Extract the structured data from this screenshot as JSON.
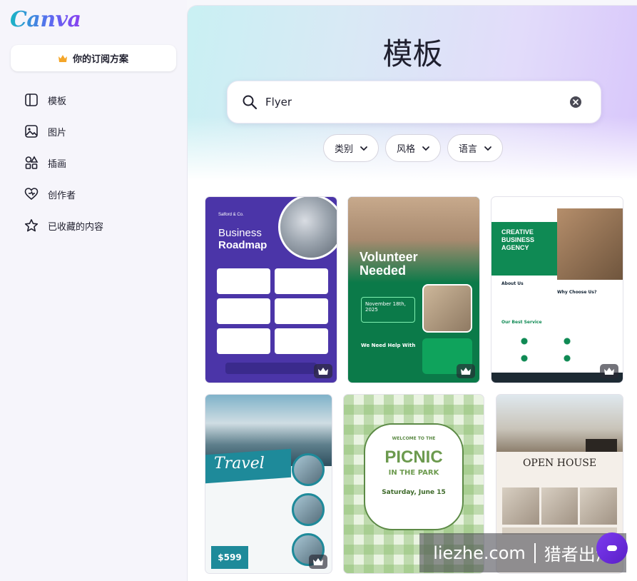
{
  "app": {
    "logo": "Canva"
  },
  "sidebar": {
    "plan_button": "你的订阅方案",
    "items": [
      {
        "label": "模板",
        "icon": "template-icon"
      },
      {
        "label": "图片",
        "icon": "image-icon"
      },
      {
        "label": "插画",
        "icon": "illustration-icon"
      },
      {
        "label": "创作者",
        "icon": "creator-heart-icon"
      },
      {
        "label": "已收藏的内容",
        "icon": "star-icon"
      }
    ]
  },
  "main": {
    "title": "模板",
    "search": {
      "value": "Flyer"
    },
    "filters": [
      "类别",
      "风格",
      "语言"
    ]
  },
  "templates": [
    {
      "name": "business-roadmap",
      "brand": "Salford & Co.",
      "title_line1": "Business",
      "title_line2": "Roadmap",
      "premium": true
    },
    {
      "name": "volunteer-needed",
      "title_line1": "Volunteer",
      "title_line2": "Needed",
      "date": "November 18th, 2025",
      "subtitle": "We Need Help With",
      "premium": true
    },
    {
      "name": "creative-business-agency",
      "title_line1": "CREATIVE",
      "title_line2": "BUSINESS",
      "title_line3": "AGENCY",
      "about": "About Us",
      "why": "Why Choose Us?",
      "service": "Our Best Service",
      "premium": true
    },
    {
      "name": "travel-the-world",
      "title": "Travel",
      "price": "$599",
      "premium": true
    },
    {
      "name": "picnic-in-the-park",
      "kicker": "WELCOME TO THE",
      "title": "PICNIC",
      "subtitle": "IN THE PARK",
      "date": "Saturday, June 15",
      "premium": false
    },
    {
      "name": "open-house",
      "title": "OPEN HOUSE",
      "premium": false
    }
  ],
  "watermark": {
    "left": "liezhe.com",
    "right": "猎者出海"
  },
  "colors": {
    "accent": "#8b3dff",
    "brand_gradient_start": "#19b5c4",
    "brand_gradient_end": "#8a3ff0"
  }
}
